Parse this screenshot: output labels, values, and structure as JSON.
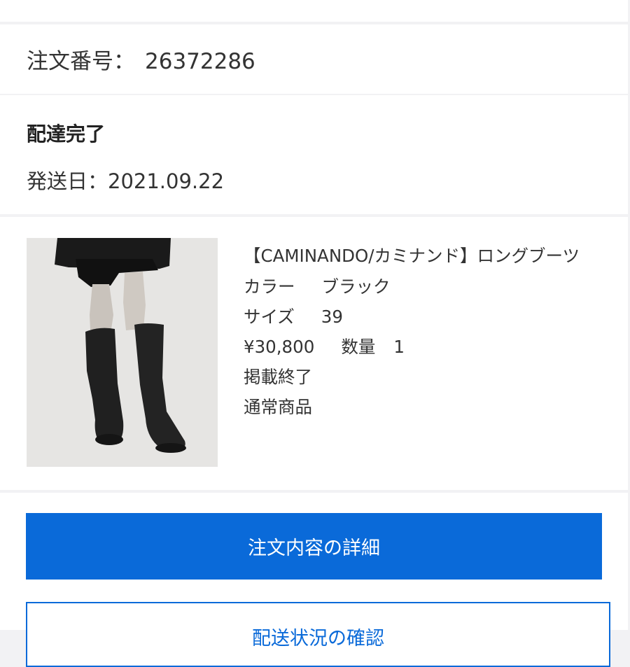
{
  "order": {
    "label": "注文番号：",
    "number": "26372286"
  },
  "status": {
    "title": "配達完了",
    "ship_date": "発送日：2021.09.22"
  },
  "item": {
    "name": "【CAMINANDO/カミナンド】ロングブーツ",
    "color_label": "カラー",
    "color_value": "ブラック",
    "size_label": "サイズ",
    "size_value": "39",
    "price": "¥30,800",
    "qty_label": "数量",
    "qty_value": "1",
    "listing_status": "掲載終了",
    "item_type": "通常商品"
  },
  "buttons": {
    "order_detail": "注文内容の詳細",
    "tracking": "配送状況の確認"
  },
  "colors": {
    "accent": "#0a6ad9",
    "background": "#f2f2f4"
  }
}
